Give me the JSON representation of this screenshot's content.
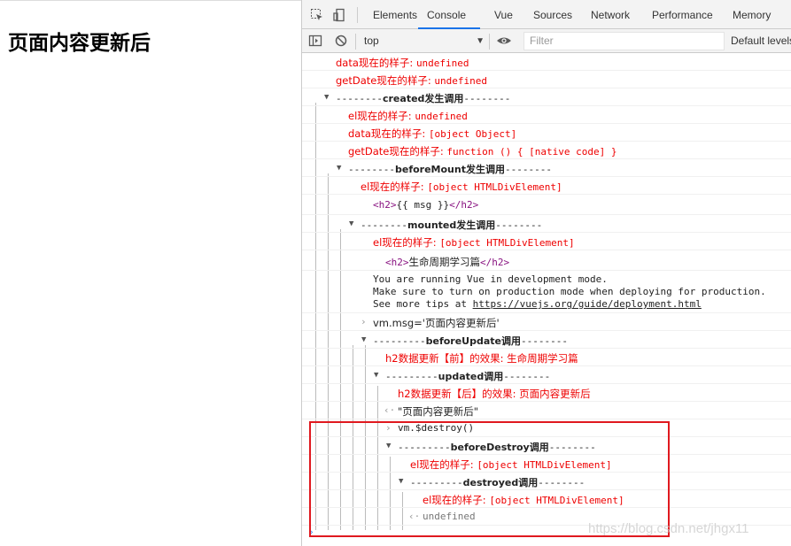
{
  "page": {
    "heading": "页面内容更新后"
  },
  "devtools": {
    "tabs": [
      "Elements",
      "Console",
      "Vue",
      "Sources",
      "Network",
      "Performance",
      "Memory"
    ],
    "active_tab": "Console",
    "context": "top",
    "filter_placeholder": "Filter",
    "levels": "Default levels",
    "icons": [
      "inspect-element-icon",
      "device-toolbar-icon",
      "sidebar-toggle-icon",
      "clear-console-icon",
      "eye-icon"
    ]
  },
  "console": {
    "r1": {
      "label": "data现在的样子: ",
      "value": "undefined"
    },
    "r2": {
      "label": "getDate现在的样子: ",
      "value": "undefined"
    },
    "r3": {
      "pre": "--------",
      "bold": "created发生调用",
      "post": "--------"
    },
    "r4": {
      "label": "el现在的样子: ",
      "value": "undefined"
    },
    "r5": {
      "label": "data现在的样子: ",
      "value": "[object Object]"
    },
    "r6": {
      "label": "getDate现在的样子: ",
      "value": "function () { [native code] }"
    },
    "r7": {
      "pre": "--------",
      "bold": "beforeMount发生调用",
      "post": "--------"
    },
    "r8": {
      "label": "el现在的样子: ",
      "value": "[object HTMLDivElement]"
    },
    "r9": {
      "open": "<h2>",
      "text": "{{ msg }}",
      "close": "</h2>"
    },
    "r10": {
      "pre": "--------",
      "bold": "mounted发生调用",
      "post": "--------"
    },
    "r11": {
      "label": "el现在的样子: ",
      "value": "[object HTMLDivElement]"
    },
    "r12": {
      "open": "<h2>",
      "text": "生命周期学习篇",
      "close": "</h2>"
    },
    "r13": {
      "line1": "You are running Vue in development mode.",
      "line2": "Make sure to turn on production mode when deploying for production.",
      "line3_pre": "See more tips at ",
      "link": "https://vuejs.org/guide/deployment.html"
    },
    "r14": {
      "cmd": "vm.msg='页面内容更新后'"
    },
    "r15": {
      "pre": "---------",
      "bold": "beforeUpdate调用",
      "post": "--------"
    },
    "r16": {
      "text": "h2数据更新【前】的效果: 生命周期学习篇"
    },
    "r17": {
      "pre": "---------",
      "bold": "updated调用",
      "post": "--------"
    },
    "r18": {
      "text": "h2数据更新【后】的效果: 页面内容更新后"
    },
    "r19": {
      "result": "\"页面内容更新后\""
    },
    "r20": {
      "cmd": "vm.$destroy()"
    },
    "r21": {
      "pre": "---------",
      "bold": "beforeDestroy调用",
      "post": "--------"
    },
    "r22": {
      "label": "el现在的样子: ",
      "value": "[object HTMLDivElement]"
    },
    "r23": {
      "pre": "---------",
      "bold": "destroyed调用",
      "post": "--------"
    },
    "r24": {
      "label": "el现在的样子: ",
      "value": "[object HTMLDivElement]"
    },
    "r25": {
      "result": "undefined"
    }
  },
  "watermark": "https://blog.csdn.net/jhgx11",
  "colors": {
    "highlight_box": "#e0191f",
    "active_tab_underline": "#1a73e8",
    "log_red": "#ee0000",
    "tag_purple": "#881280"
  }
}
